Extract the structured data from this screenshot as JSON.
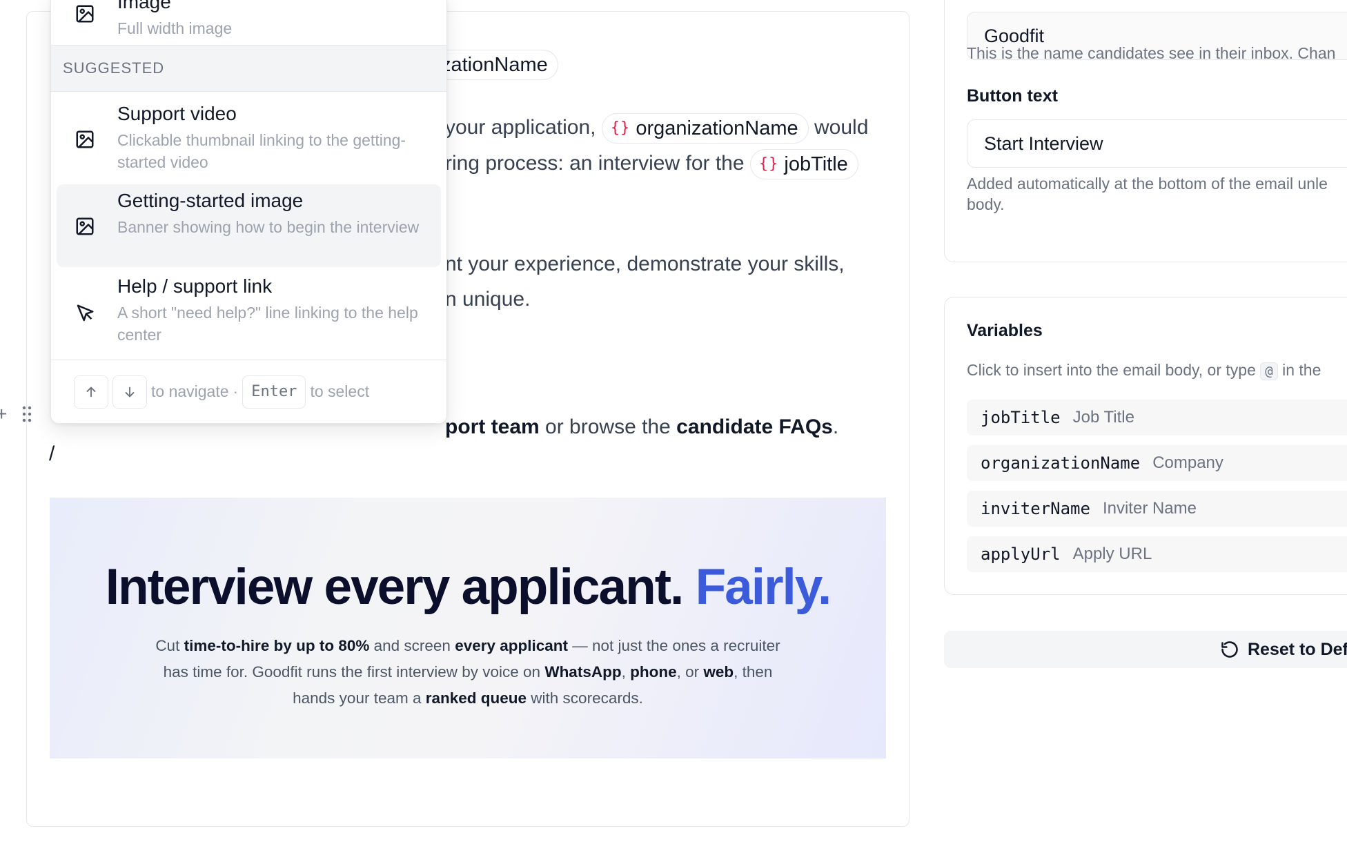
{
  "editor": {
    "line1_chip_tail": "zationName",
    "line2_prefix": "your application,",
    "line2_chip": "organizationName",
    "line2_suffix": "would",
    "line3_prefix": "ring process: an interview for the",
    "line3_chip": "jobTitle",
    "line4": "nt your experience, demonstrate your skills,",
    "line5": "n unique.",
    "line6_prefix": "port team",
    "line6_mid": "or browse the",
    "line6_link": "candidate FAQs",
    "line6_end": ".",
    "slash": "/",
    "chip_brace": "{}"
  },
  "banner": {
    "title_main": "Interview every applicant.",
    "title_accent": "Fairly.",
    "body": {
      "p1": "Cut ",
      "b1": "time-to-hire by up to 80%",
      "p2": " and screen ",
      "b2": "every applicant",
      "p3": " — not just the ones a recruiter has time for. Goodfit runs the first interview by voice on ",
      "b3": "WhatsApp",
      "p4": ", ",
      "b4": "phone",
      "p5": ", or ",
      "b5": "web",
      "p6": ", then hands your team a ",
      "b6": "ranked queue",
      "p7": " with scorecards."
    }
  },
  "slash_menu": {
    "top_item": {
      "title": "Image",
      "desc": "Full width image",
      "icon": "image-icon"
    },
    "section_label": "SUGGESTED",
    "items": [
      {
        "title": "Support video",
        "desc": "Clickable thumbnail linking to the getting-started video",
        "icon": "image-icon"
      },
      {
        "title": "Getting-started image",
        "desc": "Banner showing how to begin the interview",
        "icon": "image-icon",
        "active": true
      },
      {
        "title": "Help / support link",
        "desc": "A short \"need help?\" line linking to the help center",
        "icon": "cursor-icon"
      }
    ],
    "footer": {
      "navigate_text": "to navigate",
      "separator": "·",
      "enter_key": "Enter",
      "select_text": "to select"
    }
  },
  "panel": {
    "sender_value": "Goodfit",
    "sender_help": "This is the name candidates see in their inbox. Chan",
    "button_text_label": "Button text",
    "button_text_value": "Start Interview",
    "button_help_line1": "Added automatically at the bottom of the email unle",
    "button_help_line2": "body.",
    "variables_title": "Variables",
    "variables_help_prefix": "Click to insert into the email body, or type",
    "variables_help_code": "@",
    "variables_help_suffix": "in the",
    "variables": [
      {
        "key": "jobTitle",
        "label": "Job Title"
      },
      {
        "key": "organizationName",
        "label": "Company"
      },
      {
        "key": "inviterName",
        "label": "Inviter Name"
      },
      {
        "key": "applyUrl",
        "label": "Apply URL"
      }
    ],
    "reset_label": "Reset to Defa"
  },
  "colors": {
    "accent": "#3b5bdb",
    "chip_brace": "#e11d48",
    "muted": "#9ca3af"
  }
}
